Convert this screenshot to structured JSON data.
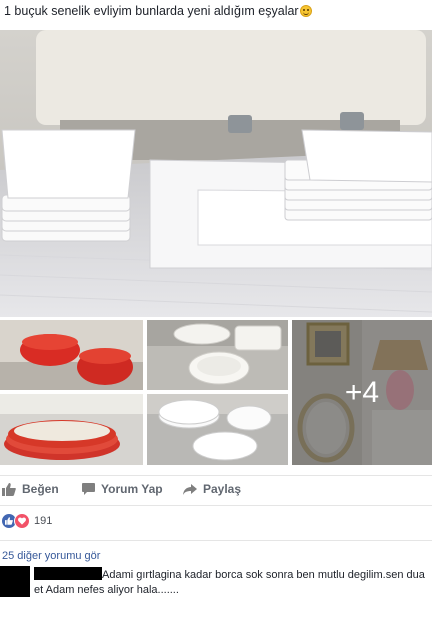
{
  "post": {
    "text": "1 buçuk senelik evliyim bunlarda yeni aldığım eşyalar",
    "emoji_icon": "smiling-face-icon"
  },
  "photos": {
    "more_count": "+4"
  },
  "actions": {
    "like_label": "Beğen",
    "comment_label": "Yorum Yap",
    "share_label": "Paylaş"
  },
  "reactions": {
    "count": "191",
    "types": [
      "like",
      "love"
    ]
  },
  "comments": {
    "view_more": "25 diğer yorumu gör",
    "items": [
      {
        "author": "",
        "text": "Adami gırtlagina kadar borca sok sonra ben mutlu degilim.sen dua et Adam nefes aliyor hala......."
      }
    ]
  },
  "colors": {
    "link": "#365899",
    "action_text": "#616770",
    "like_blue": "#4267b2",
    "love_red": "#f25268"
  }
}
